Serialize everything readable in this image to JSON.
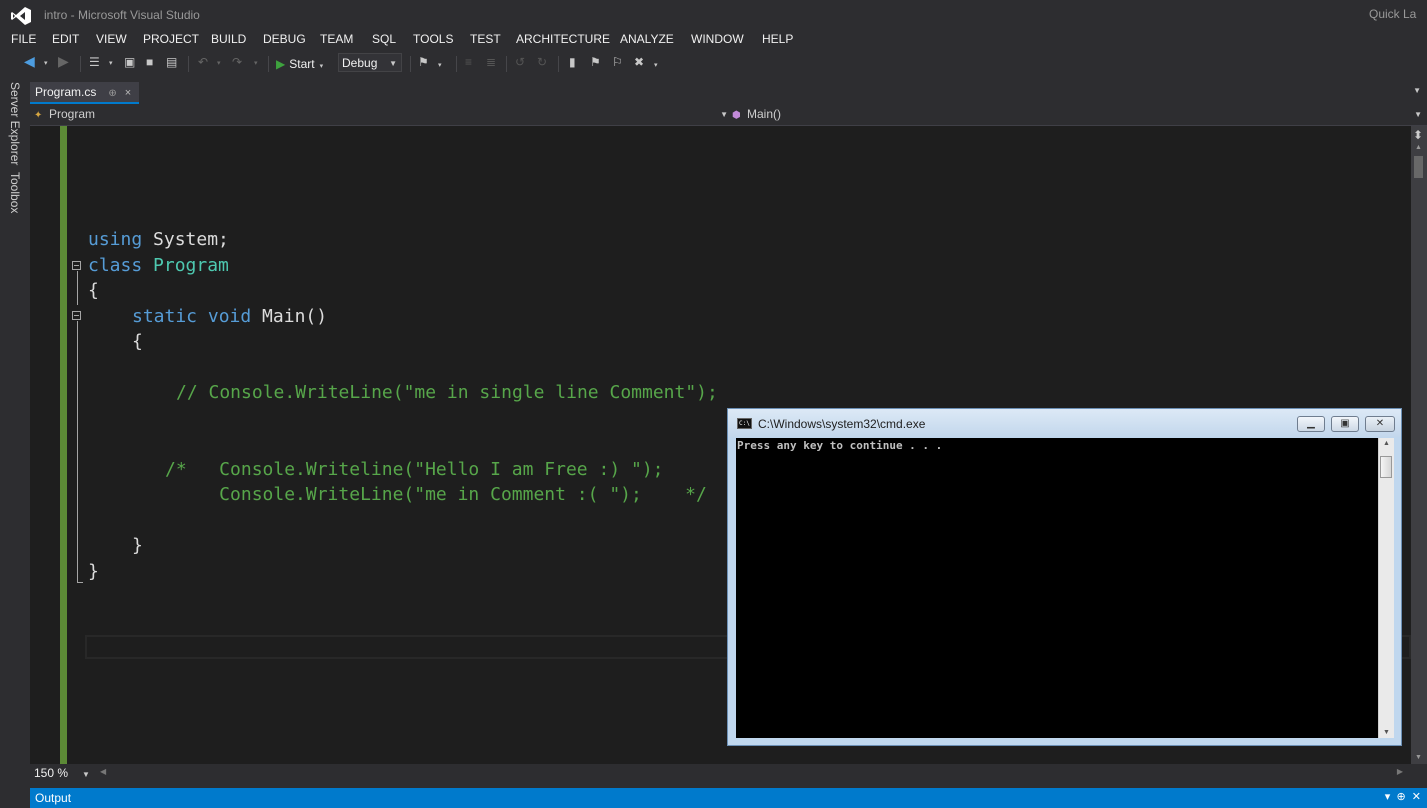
{
  "window": {
    "title": "intro - Microsoft Visual Studio",
    "quick_launch": "Quick La"
  },
  "menu": [
    "FILE",
    "EDIT",
    "VIEW",
    "PROJECT",
    "BUILD",
    "DEBUG",
    "TEAM",
    "SQL",
    "TOOLS",
    "TEST",
    "ARCHITECTURE",
    "ANALYZE",
    "WINDOW",
    "HELP"
  ],
  "toolbar": {
    "start_label": "Start",
    "configuration": "Debug"
  },
  "side_tabs": [
    "Server Explorer",
    "Toolbox"
  ],
  "document_tab": {
    "label": "Program.cs",
    "pin_symbol": "⊕",
    "close_symbol": "×"
  },
  "navigation": {
    "class": "Program",
    "member": "Main()"
  },
  "code": {
    "line_using_kw": "using",
    "line_using_rest": " System;",
    "line_class_kw": "class",
    "line_class_name": " Program",
    "open_brace_class": "{",
    "main_static": "static",
    "main_void": " void",
    "main_rest": " Main()",
    "open_brace_main": "{",
    "single_comment": "// Console.WriteLine(\"me in single line Comment\");",
    "block_comment_1": "/*   Console.Writeline(\"Hello I am Free :) \");",
    "block_comment_2": "     Console.WriteLine(\"me in Comment :( \");    */",
    "close_brace_main": "}",
    "close_brace_class": "}"
  },
  "editor_zoom": "150 %",
  "output_panel": "Output",
  "console": {
    "title": "C:\\Windows\\system32\\cmd.exe",
    "icon_text": "C:\\",
    "output": "Press any key to continue . . ."
  },
  "colors": {
    "editor_bg": "#1e1e1e",
    "keyword": "#569cd6",
    "type": "#4ec9b0",
    "comment": "#57a64a",
    "accent": "#007acc",
    "change_bar": "#5c8a36"
  }
}
